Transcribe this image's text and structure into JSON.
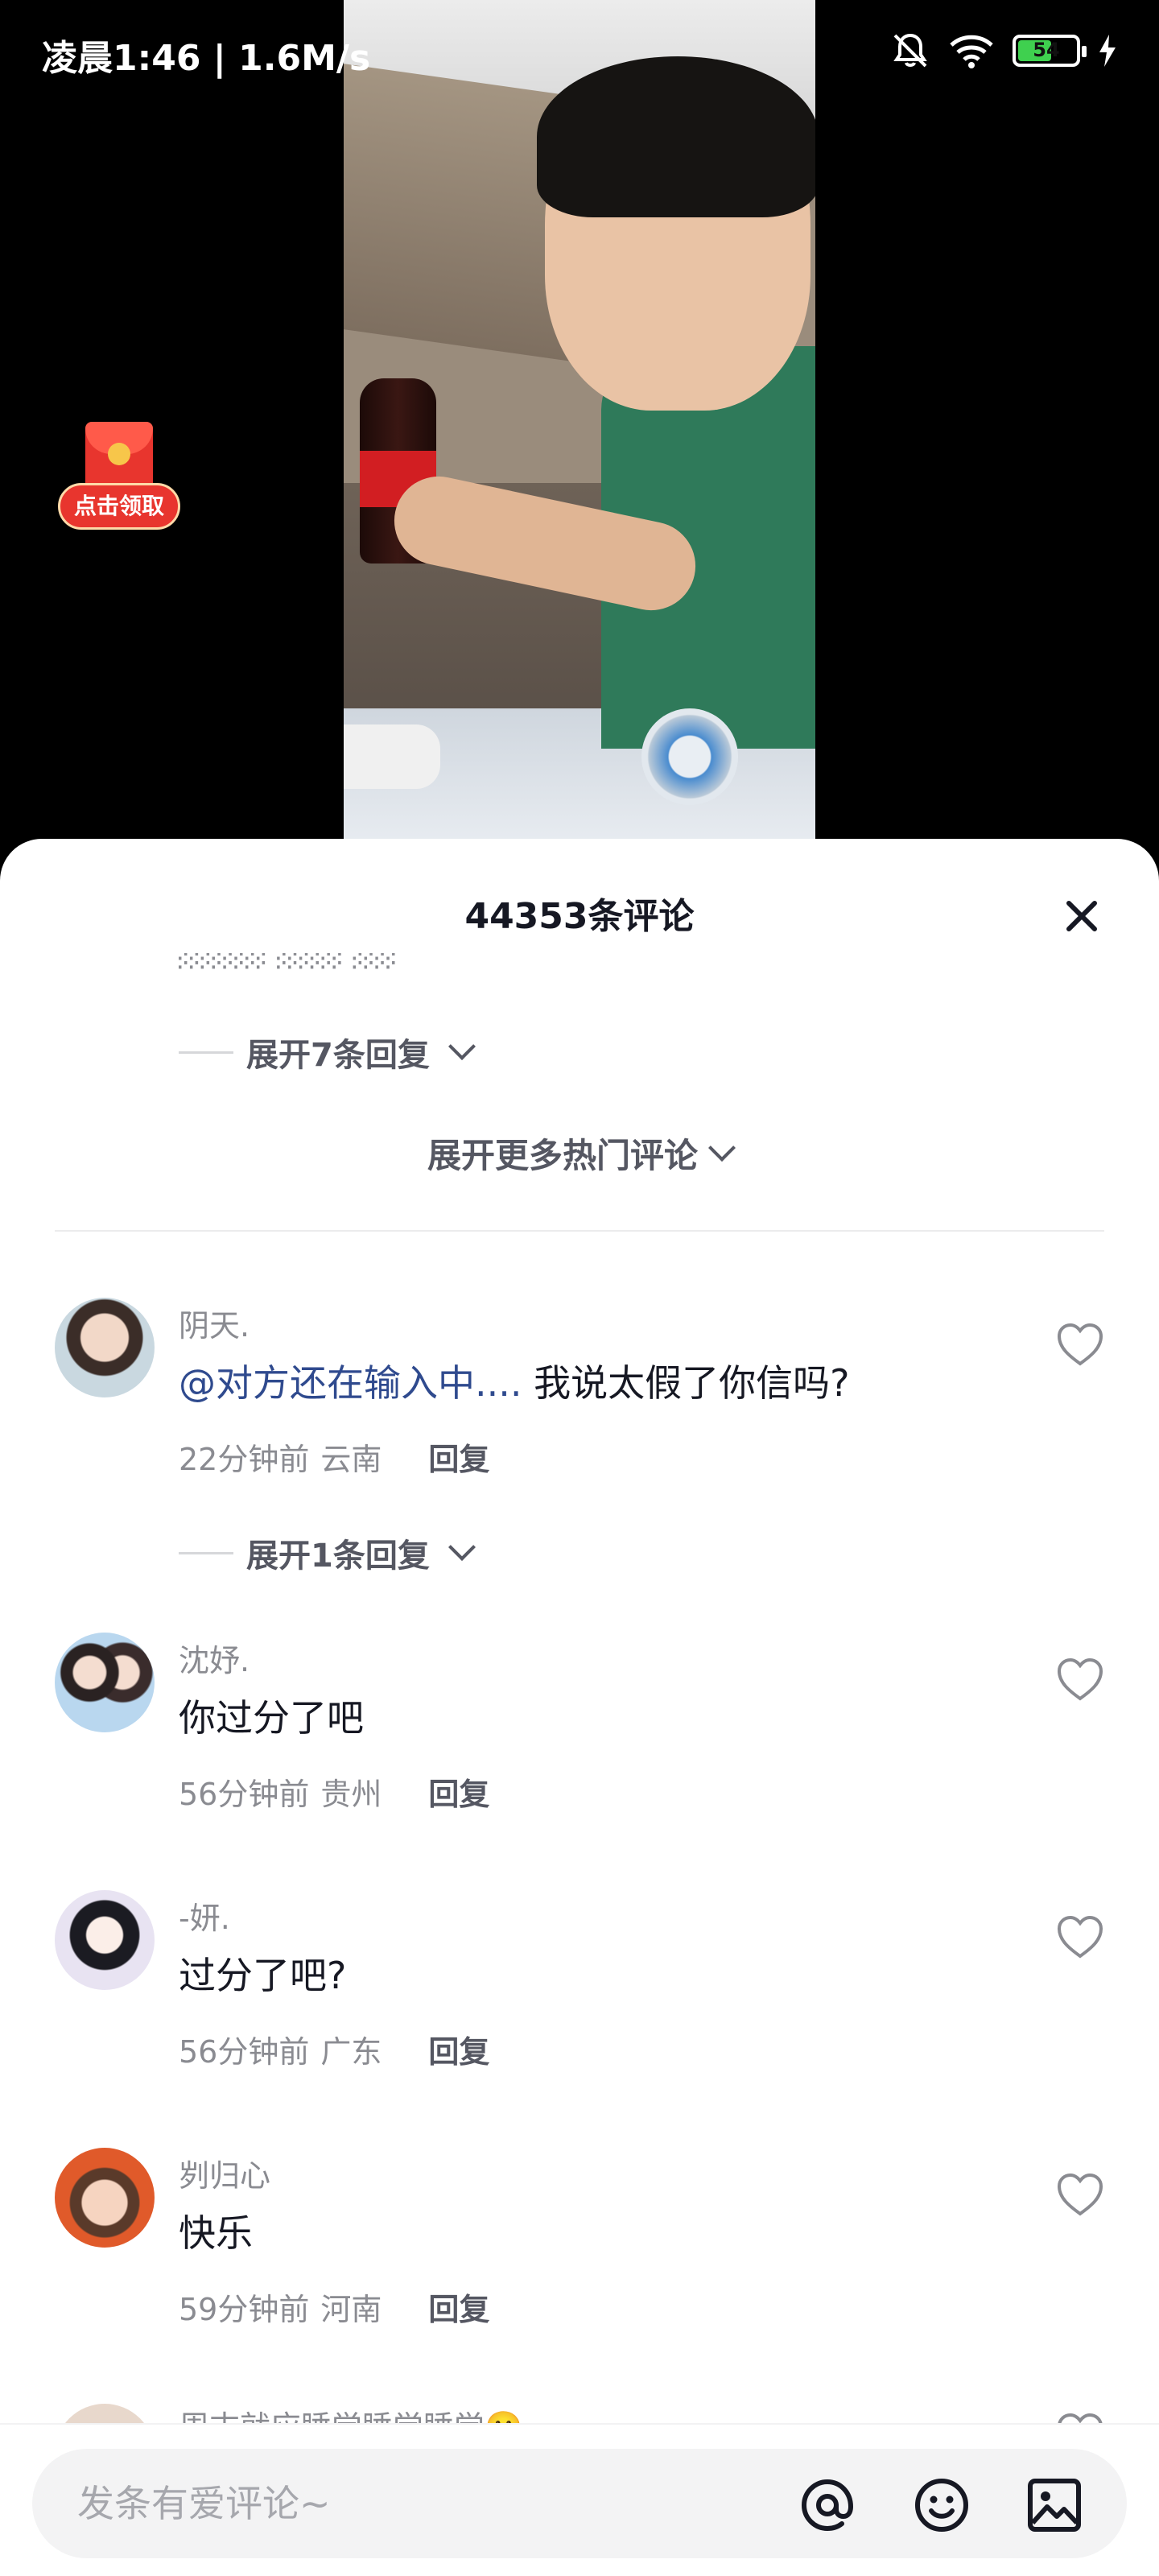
{
  "status_bar": {
    "time": "凌晨1:46 | 1.6M/s",
    "battery": "54"
  },
  "video": {
    "redpacket_label": "点击领取",
    "redpacket_icon": "red-envelope-icon"
  },
  "comments_panel": {
    "title": "44353条评论",
    "close_icon": "close-icon",
    "expand_replies_top": "展开7条回复",
    "more_hot": "展开更多热门评论",
    "comments": [
      {
        "user": "阴天.",
        "mention": "@对方还在输入中....",
        "text": " 我说太假了你信吗?",
        "time": "22分钟前",
        "location": "云南",
        "reply": "回复",
        "expand": "展开1条回复"
      },
      {
        "user": "沈妤.",
        "text": "你过分了吧",
        "time": "56分钟前",
        "location": "贵州",
        "reply": "回复"
      },
      {
        "user": "-妍.",
        "text": "过分了吧?",
        "time": "56分钟前",
        "location": "广东",
        "reply": "回复"
      },
      {
        "user": "刿归心",
        "text": "快乐",
        "time": "59分钟前",
        "location": "河南",
        "reply": "回复"
      }
    ],
    "partial_user": "周末就应睡觉睡觉睡觉🙂"
  },
  "input_bar": {
    "placeholder": "发条有爱评论~",
    "icons": [
      "at-icon",
      "emoji-icon",
      "image-icon"
    ]
  },
  "colors": {
    "mention": "#2f4a8e",
    "battery": "#3fd04f",
    "redpacket": "#e8352e"
  }
}
